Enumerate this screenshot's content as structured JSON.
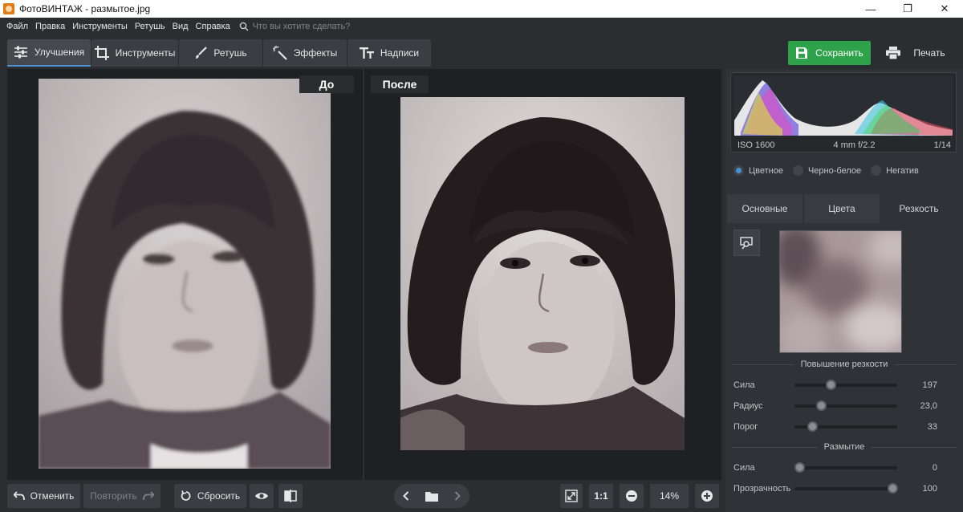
{
  "window": {
    "title": "ФотоВИНТАЖ - размытое.jpg",
    "minimize": "—",
    "maximize": "❐",
    "close": "✕"
  },
  "menu": {
    "items": [
      "Файл",
      "Правка",
      "Инструменты",
      "Ретушь",
      "Вид",
      "Справка"
    ],
    "search_placeholder": "Что вы хотите сделать?"
  },
  "tabs": [
    {
      "label": "Улучшения",
      "icon": "sliders-icon",
      "active": true
    },
    {
      "label": "Инструменты",
      "icon": "crop-icon"
    },
    {
      "label": "Ретушь",
      "icon": "brush-icon"
    },
    {
      "label": "Эффекты",
      "icon": "magic-wand-icon"
    },
    {
      "label": "Надписи",
      "icon": "text-icon"
    }
  ],
  "actions": {
    "save": "Сохранить",
    "print": "Печать",
    "accent": "#2ea24a"
  },
  "canvas": {
    "before_label": "До",
    "after_label": "После"
  },
  "bottom": {
    "undo": "Отменить",
    "redo": "Повторить",
    "reset": "Сбросить",
    "ratio": "1:1",
    "zoom": "14%"
  },
  "histogram": {
    "iso": "ISO 1600",
    "lens": "4 mm f/2.2",
    "shutter": "1/14"
  },
  "color_mode": {
    "options": [
      "Цветное",
      "Черно-белое",
      "Негатив"
    ],
    "selected": "Цветное"
  },
  "subtabs": {
    "items": [
      "Основные",
      "Цвета",
      "Резкость"
    ],
    "active": "Резкость"
  },
  "sharpen": {
    "title": "Повышение резкости",
    "sliders": [
      {
        "name": "Сила",
        "value": "197",
        "fraction": 0.35
      },
      {
        "name": "Радиус",
        "value": "23,0",
        "fraction": 0.26
      },
      {
        "name": "Порог",
        "value": "33",
        "fraction": 0.17
      }
    ]
  },
  "blur": {
    "title": "Размытие",
    "sliders": [
      {
        "name": "Сила",
        "value": "0",
        "fraction": 0.05
      },
      {
        "name": "Прозрачность",
        "value": "100",
        "fraction": 0.95
      }
    ]
  }
}
